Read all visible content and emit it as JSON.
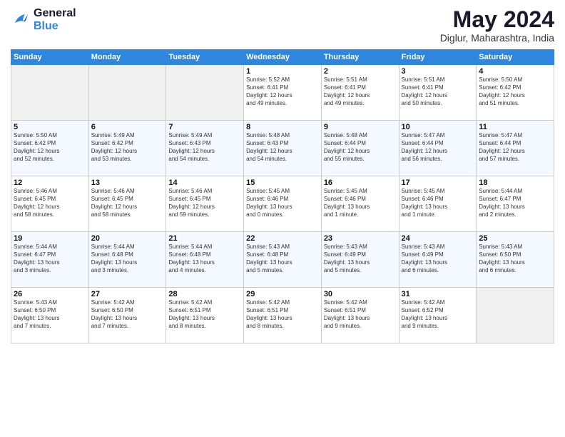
{
  "logo": {
    "line1": "General",
    "line2": "Blue"
  },
  "title": "May 2024",
  "location": "Diglur, Maharashtra, India",
  "days_of_week": [
    "Sunday",
    "Monday",
    "Tuesday",
    "Wednesday",
    "Thursday",
    "Friday",
    "Saturday"
  ],
  "weeks": [
    [
      {
        "day": "",
        "info": ""
      },
      {
        "day": "",
        "info": ""
      },
      {
        "day": "",
        "info": ""
      },
      {
        "day": "1",
        "info": "Sunrise: 5:52 AM\nSunset: 6:41 PM\nDaylight: 12 hours\nand 49 minutes."
      },
      {
        "day": "2",
        "info": "Sunrise: 5:51 AM\nSunset: 6:41 PM\nDaylight: 12 hours\nand 49 minutes."
      },
      {
        "day": "3",
        "info": "Sunrise: 5:51 AM\nSunset: 6:41 PM\nDaylight: 12 hours\nand 50 minutes."
      },
      {
        "day": "4",
        "info": "Sunrise: 5:50 AM\nSunset: 6:42 PM\nDaylight: 12 hours\nand 51 minutes."
      }
    ],
    [
      {
        "day": "5",
        "info": "Sunrise: 5:50 AM\nSunset: 6:42 PM\nDaylight: 12 hours\nand 52 minutes."
      },
      {
        "day": "6",
        "info": "Sunrise: 5:49 AM\nSunset: 6:42 PM\nDaylight: 12 hours\nand 53 minutes."
      },
      {
        "day": "7",
        "info": "Sunrise: 5:49 AM\nSunset: 6:43 PM\nDaylight: 12 hours\nand 54 minutes."
      },
      {
        "day": "8",
        "info": "Sunrise: 5:48 AM\nSunset: 6:43 PM\nDaylight: 12 hours\nand 54 minutes."
      },
      {
        "day": "9",
        "info": "Sunrise: 5:48 AM\nSunset: 6:44 PM\nDaylight: 12 hours\nand 55 minutes."
      },
      {
        "day": "10",
        "info": "Sunrise: 5:47 AM\nSunset: 6:44 PM\nDaylight: 12 hours\nand 56 minutes."
      },
      {
        "day": "11",
        "info": "Sunrise: 5:47 AM\nSunset: 6:44 PM\nDaylight: 12 hours\nand 57 minutes."
      }
    ],
    [
      {
        "day": "12",
        "info": "Sunrise: 5:46 AM\nSunset: 6:45 PM\nDaylight: 12 hours\nand 58 minutes."
      },
      {
        "day": "13",
        "info": "Sunrise: 5:46 AM\nSunset: 6:45 PM\nDaylight: 12 hours\nand 58 minutes."
      },
      {
        "day": "14",
        "info": "Sunrise: 5:46 AM\nSunset: 6:45 PM\nDaylight: 12 hours\nand 59 minutes."
      },
      {
        "day": "15",
        "info": "Sunrise: 5:45 AM\nSunset: 6:46 PM\nDaylight: 13 hours\nand 0 minutes."
      },
      {
        "day": "16",
        "info": "Sunrise: 5:45 AM\nSunset: 6:46 PM\nDaylight: 13 hours\nand 1 minute."
      },
      {
        "day": "17",
        "info": "Sunrise: 5:45 AM\nSunset: 6:46 PM\nDaylight: 13 hours\nand 1 minute."
      },
      {
        "day": "18",
        "info": "Sunrise: 5:44 AM\nSunset: 6:47 PM\nDaylight: 13 hours\nand 2 minutes."
      }
    ],
    [
      {
        "day": "19",
        "info": "Sunrise: 5:44 AM\nSunset: 6:47 PM\nDaylight: 13 hours\nand 3 minutes."
      },
      {
        "day": "20",
        "info": "Sunrise: 5:44 AM\nSunset: 6:48 PM\nDaylight: 13 hours\nand 3 minutes."
      },
      {
        "day": "21",
        "info": "Sunrise: 5:44 AM\nSunset: 6:48 PM\nDaylight: 13 hours\nand 4 minutes."
      },
      {
        "day": "22",
        "info": "Sunrise: 5:43 AM\nSunset: 6:48 PM\nDaylight: 13 hours\nand 5 minutes."
      },
      {
        "day": "23",
        "info": "Sunrise: 5:43 AM\nSunset: 6:49 PM\nDaylight: 13 hours\nand 5 minutes."
      },
      {
        "day": "24",
        "info": "Sunrise: 5:43 AM\nSunset: 6:49 PM\nDaylight: 13 hours\nand 6 minutes."
      },
      {
        "day": "25",
        "info": "Sunrise: 5:43 AM\nSunset: 6:50 PM\nDaylight: 13 hours\nand 6 minutes."
      }
    ],
    [
      {
        "day": "26",
        "info": "Sunrise: 5:43 AM\nSunset: 6:50 PM\nDaylight: 13 hours\nand 7 minutes."
      },
      {
        "day": "27",
        "info": "Sunrise: 5:42 AM\nSunset: 6:50 PM\nDaylight: 13 hours\nand 7 minutes."
      },
      {
        "day": "28",
        "info": "Sunrise: 5:42 AM\nSunset: 6:51 PM\nDaylight: 13 hours\nand 8 minutes."
      },
      {
        "day": "29",
        "info": "Sunrise: 5:42 AM\nSunset: 6:51 PM\nDaylight: 13 hours\nand 8 minutes."
      },
      {
        "day": "30",
        "info": "Sunrise: 5:42 AM\nSunset: 6:51 PM\nDaylight: 13 hours\nand 9 minutes."
      },
      {
        "day": "31",
        "info": "Sunrise: 5:42 AM\nSunset: 6:52 PM\nDaylight: 13 hours\nand 9 minutes."
      },
      {
        "day": "",
        "info": ""
      }
    ]
  ]
}
